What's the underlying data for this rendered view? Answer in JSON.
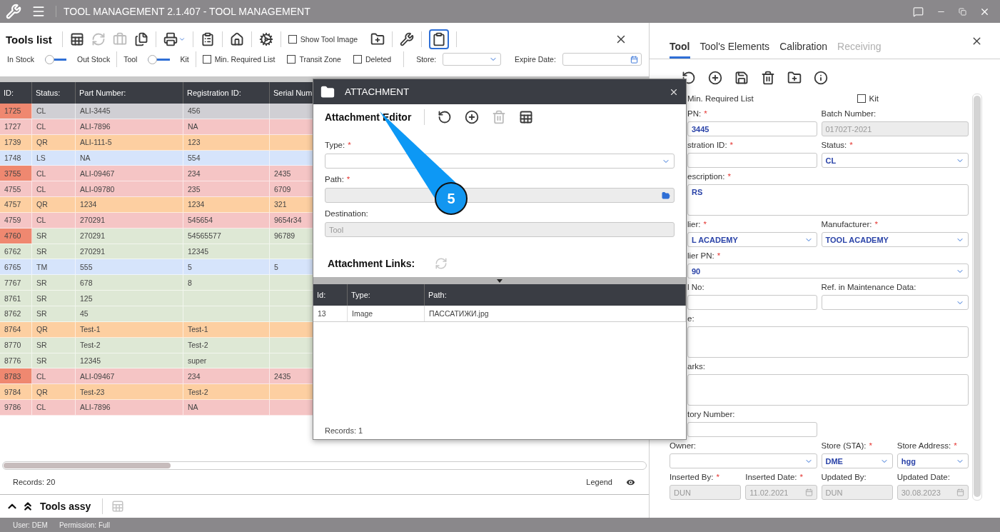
{
  "window": {
    "title": "TOOL MANAGEMENT 2.1.407 - TOOL MANAGEMENT"
  },
  "tools_list": {
    "title": "Tools list",
    "toolbar": [
      {
        "kind": "spreadsheet",
        "disabled": false
      },
      {
        "kind": "refresh",
        "disabled": true
      },
      {
        "kind": "toolbox",
        "disabled": true
      },
      {
        "kind": "export",
        "disabled": false
      },
      {
        "kind": "printer",
        "disabled": false
      },
      {
        "kind": "clipboard",
        "disabled": false
      },
      {
        "kind": "home",
        "disabled": false
      },
      {
        "kind": "gear",
        "disabled": false
      },
      {
        "kind": "checkbox",
        "label": "Show Tool Image",
        "checked": false
      },
      {
        "kind": "folder",
        "disabled": false
      },
      {
        "kind": "tools",
        "disabled": false
      },
      {
        "kind": "note",
        "disabled": false,
        "active": true
      }
    ],
    "toggles": [
      {
        "left": "In Stock",
        "right": "Out Stock",
        "on": false
      },
      {
        "left": "Tool",
        "right": "Kit",
        "on": false
      }
    ],
    "checkboxes": [
      {
        "label": "Min. Required List",
        "checked": false
      },
      {
        "label": "Transit Zone",
        "checked": false
      },
      {
        "label": "Deleted",
        "checked": false
      }
    ],
    "store": {
      "label": "Store:"
    },
    "expire_date": {
      "label": "Expire Date:"
    },
    "table": {
      "columns": [
        "ID:",
        "Status:",
        "Part Number:",
        "Registration ID:",
        "Serial Num"
      ],
      "rows": [
        {
          "id": "1725",
          "status": "CL",
          "part_number": "ALI-3445",
          "registration_id": "456",
          "color": "#d0cfd4",
          "flagged": true
        },
        {
          "id": "1727",
          "status": "CL",
          "part_number": "ALI-7896",
          "registration_id": "NA",
          "color": "#f5c5c5",
          "flagged": false
        },
        {
          "id": "1739",
          "status": "QR",
          "part_number": "ALI-111-5",
          "registration_id": "123",
          "color": "#fdcfa1",
          "flagged": false
        },
        {
          "id": "1748",
          "status": "LS",
          "part_number": "NA",
          "registration_id": "554",
          "color": "#d6e4fb",
          "flagged": false
        },
        {
          "id": "3755",
          "status": "CL",
          "part_number": "ALI-09467",
          "registration_id": "234",
          "serial": "2435",
          "color": "#f5c5c5",
          "flagged": true
        },
        {
          "id": "4755",
          "status": "CL",
          "part_number": "ALI-09780",
          "registration_id": "235",
          "serial": "6709",
          "color": "#f5c5c5",
          "flagged": false
        },
        {
          "id": "4757",
          "status": "QR",
          "part_number": "1234",
          "registration_id": "1234",
          "serial": "321",
          "color": "#fdcfa1",
          "flagged": false
        },
        {
          "id": "4759",
          "status": "CL",
          "part_number": "270291",
          "registration_id": "545654",
          "serial": "9654r34",
          "color": "#f5c5c5",
          "flagged": false
        },
        {
          "id": "4760",
          "status": "SR",
          "part_number": "270291",
          "registration_id": "54565577",
          "serial": "96789",
          "color": "#dee8d5",
          "flagged": true
        },
        {
          "id": "6762",
          "status": "SR",
          "part_number": "270291",
          "registration_id": "12345",
          "color": "#dee8d5",
          "flagged": false
        },
        {
          "id": "6765",
          "status": "TM",
          "part_number": "555",
          "registration_id": "5",
          "serial": "5",
          "color": "#d6e4fb",
          "flagged": false
        },
        {
          "id": "7767",
          "status": "SR",
          "part_number": "678",
          "registration_id": "8",
          "color": "#dee8d5",
          "flagged": false
        },
        {
          "id": "8761",
          "status": "SR",
          "part_number": "125",
          "color": "#dee8d5",
          "flagged": false
        },
        {
          "id": "8762",
          "status": "SR",
          "part_number": "45",
          "color": "#dee8d5",
          "flagged": false
        },
        {
          "id": "8764",
          "status": "QR",
          "part_number": "Test-1",
          "registration_id": "Test-1",
          "color": "#fdcfa1",
          "flagged": false
        },
        {
          "id": "8770",
          "status": "SR",
          "part_number": "Test-2",
          "registration_id": "Test-2",
          "color": "#dee8d5",
          "flagged": false
        },
        {
          "id": "8776",
          "status": "SR",
          "part_number": "12345",
          "registration_id": "super",
          "color": "#dee8d5",
          "flagged": false
        },
        {
          "id": "8783",
          "status": "CL",
          "part_number": "ALI-09467",
          "registration_id": "234",
          "serial": "2435",
          "color": "#f5c5c5",
          "flagged": true
        },
        {
          "id": "9784",
          "status": "QR",
          "part_number": "Test-23",
          "registration_id": "Test-2",
          "color": "#fdcfa1",
          "flagged": false
        },
        {
          "id": "9786",
          "status": "CL",
          "part_number": "ALI-7896",
          "registration_id": "NA",
          "color": "#f5c5c5",
          "flagged": false
        }
      ]
    },
    "records": "Records: 20",
    "legend": "Legend"
  },
  "tools_assy": {
    "title": "Tools assy"
  },
  "attachment_dialog": {
    "title": "ATTACHMENT",
    "editor_title": "Attachment Editor",
    "toolbar": [
      {
        "kind": "undo",
        "disabled": false
      },
      {
        "kind": "add",
        "disabled": false
      },
      {
        "kind": "delete",
        "disabled": true
      },
      {
        "kind": "spreadsheet",
        "disabled": false
      }
    ],
    "fields": [
      {
        "kind": "select",
        "label": "Type:",
        "mark": "*",
        "disabled": false
      },
      {
        "kind": "file",
        "label": "Path:",
        "mark": "*",
        "disabled": true
      },
      {
        "kind": "input",
        "label": "Destination:",
        "value": "Tool",
        "disabled": true
      }
    ],
    "links_title": "Attachment Links:",
    "columns": [
      "Id:",
      "Type:",
      "Path:"
    ],
    "rows": [
      [
        "13",
        "Image",
        "ПАССАТИЖИ.jpg"
      ]
    ],
    "records": "Records: 1"
  },
  "callout": {
    "label": "5"
  },
  "detail": {
    "tabs": [
      {
        "label": "Tool",
        "selected": true,
        "disabled": false
      },
      {
        "label": "Tool's Elements",
        "selected": false,
        "disabled": false
      },
      {
        "label": "Calibration",
        "selected": false,
        "disabled": false
      },
      {
        "label": "Receiving",
        "selected": false,
        "disabled": true
      }
    ],
    "toolbar": [
      {
        "kind": "undo",
        "disabled": false
      },
      {
        "kind": "add",
        "disabled": false
      },
      {
        "kind": "save",
        "disabled": false
      },
      {
        "kind": "delete",
        "disabled": false
      },
      {
        "kind": "folder",
        "disabled": false
      },
      {
        "kind": "info",
        "disabled": false
      }
    ],
    "form": [
      [
        {
          "kind": "caption",
          "label": "Min. Required List"
        },
        {
          "kind": "checkbox",
          "label": "Kit",
          "checked": false
        }
      ],
      [
        {
          "kind": "input",
          "label": "PN:",
          "mark": "*",
          "value": "3445",
          "disabled": false
        },
        {
          "kind": "input",
          "label": "Batch Number:",
          "value": "01702T-2021",
          "disabled": true
        }
      ],
      [
        {
          "kind": "input",
          "label": "stration ID:",
          "mark": "*",
          "disabled": false
        },
        {
          "kind": "select",
          "label": "Status:",
          "mark": "*",
          "value": "CL",
          "disabled": false
        }
      ],
      [
        {
          "kind": "textarea",
          "label": "escription:",
          "mark": "*",
          "value": "RS",
          "disabled": false
        }
      ],
      [
        {
          "kind": "select",
          "label": "lier:",
          "mark": "*",
          "value": "L ACADEMY",
          "disabled": false
        },
        {
          "kind": "select",
          "label": "Manufacturer:",
          "mark": "*",
          "value": "TOOL ACADEMY",
          "disabled": false
        }
      ],
      [
        {
          "kind": "select",
          "label": "lier PN:",
          "mark": "*",
          "value": "90",
          "disabled": false
        }
      ],
      [
        {
          "kind": "input",
          "label": "l No:",
          "disabled": false
        },
        {
          "kind": "select",
          "label": "Ref. in Maintenance Data:",
          "disabled": false
        }
      ],
      [
        {
          "kind": "textarea",
          "label": "e:",
          "disabled": false
        }
      ],
      [
        {
          "kind": "textarea",
          "label": "arks:",
          "disabled": false
        }
      ],
      [
        {
          "kind": "input",
          "label": "tory Number:",
          "disabled": false
        }
      ],
      [
        {
          "kind": "select",
          "label": "Owner:",
          "disabled": false
        },
        {
          "kind": "select",
          "label": "Store (STA):",
          "mark": "*",
          "value": "DME",
          "disabled": false
        },
        {
          "kind": "select",
          "label": "Store Address:",
          "mark": "*",
          "value": "hgg",
          "disabled": false
        }
      ],
      [
        {
          "kind": "input",
          "label": "Inserted By:",
          "mark": "*",
          "value": "DUN",
          "disabled": true
        },
        {
          "kind": "date",
          "label": "Inserted Date:",
          "mark": "*",
          "value": "11.02.2021",
          "disabled": true
        },
        {
          "kind": "input",
          "label": "Updated By:",
          "value": "DUN",
          "disabled": true
        },
        {
          "kind": "date",
          "label": "Updated Date:",
          "value": "30.08.2023",
          "disabled": true
        }
      ]
    ]
  },
  "status_bar": [
    "User: DEM",
    "Permission: Full"
  ]
}
